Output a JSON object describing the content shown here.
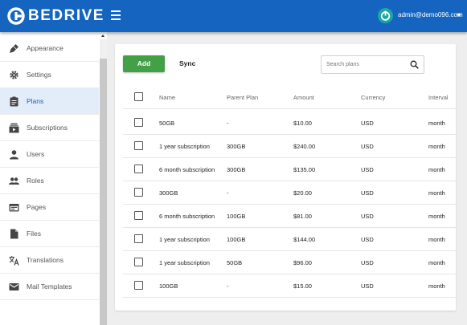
{
  "app": {
    "logo_text": "BEDRIVE",
    "user_email": "admin@demo096.com"
  },
  "colors": {
    "topbar": "#1565c0",
    "add_button": "#43a047",
    "active_nav_bg": "#e3ecf9",
    "avatar": "#1ba8a4"
  },
  "sidebar": {
    "items": [
      {
        "label": "Appearance",
        "icon": "brush-icon",
        "active": false
      },
      {
        "label": "Settings",
        "icon": "gear-icon",
        "active": false
      },
      {
        "label": "Plans",
        "icon": "clipboard-icon",
        "active": true
      },
      {
        "label": "Subscriptions",
        "icon": "subscriptions-icon",
        "active": false
      },
      {
        "label": "Users",
        "icon": "person-icon",
        "active": false
      },
      {
        "label": "Roles",
        "icon": "people-icon",
        "active": false
      },
      {
        "label": "Pages",
        "icon": "web-page-icon",
        "active": false
      },
      {
        "label": "Files",
        "icon": "file-icon",
        "active": false
      },
      {
        "label": "Translations",
        "icon": "translate-icon",
        "active": false
      },
      {
        "label": "Mail Templates",
        "icon": "mail-icon",
        "active": false
      }
    ]
  },
  "toolbar": {
    "add_label": "Add",
    "sync_label": "Sync",
    "search_placeholder": "Search plans"
  },
  "table": {
    "columns": [
      "Name",
      "Parent Plan",
      "Amount",
      "Currency",
      "Interval"
    ],
    "rows": [
      [
        "50GB",
        "-",
        "$10.00",
        "USD",
        "month"
      ],
      [
        "1 year subscription",
        "300GB",
        "$240.00",
        "USD",
        "month"
      ],
      [
        "6 month subscription",
        "300GB",
        "$135.00",
        "USD",
        "month"
      ],
      [
        "300GB",
        "-",
        "$20.00",
        "USD",
        "month"
      ],
      [
        "6 month subscription",
        "100GB",
        "$81.00",
        "USD",
        "month"
      ],
      [
        "1 year subscription",
        "100GB",
        "$144.00",
        "USD",
        "month"
      ],
      [
        "1 year subscription",
        "50GB",
        "$96.00",
        "USD",
        "month"
      ],
      [
        "100GB",
        "-",
        "$15.00",
        "USD",
        "month"
      ]
    ]
  }
}
